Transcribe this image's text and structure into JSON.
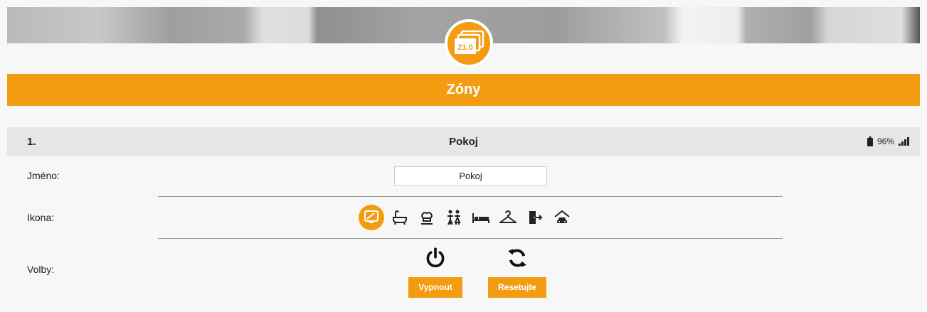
{
  "header": {
    "logo_value": "21.0",
    "page_title": "Zóny"
  },
  "zone": {
    "number": "1.",
    "name": "Pokoj",
    "battery_percent": "96%"
  },
  "form": {
    "name_label": "Jméno:",
    "name_value": "Pokoj",
    "icon_label": "Ikona:",
    "icons": [
      "monitor-icon",
      "bathtub-icon",
      "kitchen-icon",
      "children-icon",
      "bed-icon",
      "hanger-icon",
      "door-exit-icon",
      "garage-car-icon"
    ],
    "selected_icon": "monitor-icon",
    "options_label": "Volby:",
    "power_off_label": "Vypnout",
    "reset_label": "Resetujte"
  },
  "colors": {
    "accent": "#f39c12",
    "header_row": "#e6e6e6",
    "background": "#f7f7f7"
  }
}
